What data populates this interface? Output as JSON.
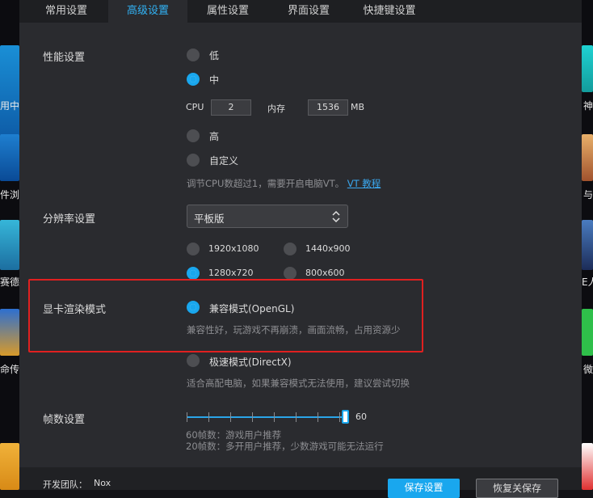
{
  "tabs": [
    "常用设置",
    "高级设置",
    "属性设置",
    "界面设置",
    "快捷键设置"
  ],
  "active_tab": 1,
  "performance": {
    "label": "性能设置",
    "options": [
      "低",
      "中",
      "高",
      "自定义"
    ],
    "selected": 1,
    "cpu_label": "CPU",
    "cpu_value": "2",
    "mem_label": "内存",
    "mem_value": "1536",
    "mem_unit": "MB",
    "hint": "调节CPU数超过1，需要开启电脑VT。",
    "hint_link": "VT 教程"
  },
  "resolution": {
    "label": "分辨率设置",
    "select_value": "平板版",
    "options": [
      "1920x1080",
      "1440x900",
      "1280x720",
      "800x600"
    ],
    "selected": 2
  },
  "render": {
    "label": "显卡渲染模式",
    "opengl_label": "兼容模式(OpenGL)",
    "opengl_desc": "兼容性好，玩游戏不再崩溃，画面流畅，占用资源少",
    "directx_label": "极速模式(DirectX)",
    "directx_desc": "适合高配电脑，如果兼容模式无法使用，建议尝试切换",
    "selected": 0
  },
  "fps": {
    "label": "帧数设置",
    "value": "60",
    "hint1": "60帧数：游戏用户推荐",
    "hint2": "20帧数：多开用户推荐，少数游戏可能无法运行"
  },
  "footer": {
    "team_label": "开发团队：",
    "team_value": "Nox",
    "save_label": "保存设置",
    "restore_label": "恢复关保存"
  },
  "side_left_labels": [
    "用中",
    "件浏",
    "赛德",
    "命传"
  ],
  "side_right_labels": [
    "神",
    "与",
    "E人",
    "微"
  ],
  "colors": {
    "accent": "#19a7ee",
    "highlight": "#e02020",
    "bg": "#2a2b2f"
  }
}
